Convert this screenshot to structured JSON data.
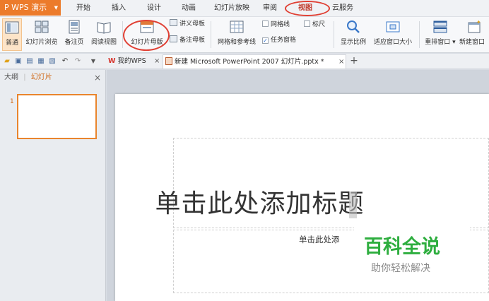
{
  "app": {
    "name": "WPS 演示"
  },
  "menu": {
    "tabs": [
      "开始",
      "插入",
      "设计",
      "动画",
      "幻灯片放映",
      "审阅",
      "视图",
      "云服务"
    ],
    "active": "视图"
  },
  "ribbon": {
    "buttons": [
      "普通",
      "幻灯片浏览",
      "备注页",
      "阅读视图",
      "幻灯片母版",
      "网格和参考线",
      "显示比例",
      "适应窗口大小",
      "重排窗口",
      "新建窗口"
    ],
    "small": {
      "handout_master": "讲义母板",
      "notes_master": "备注母板",
      "gridlines": "网格线",
      "ruler": "标尺",
      "task_pane": "任务窗格"
    }
  },
  "doc_tabs": [
    {
      "label": "我的WPS",
      "close": "×"
    },
    {
      "label": "新建 Microsoft PowerPoint 2007 幻灯片.pptx *",
      "close": "×"
    }
  ],
  "new_tab": "+",
  "sidebar": {
    "tab_outline": "大纲",
    "tab_slides": "幻灯片",
    "close": "×",
    "slide_number": "1"
  },
  "slide": {
    "title": "单击此处添加标题",
    "subtitle": "单击此处添"
  },
  "watermark": {
    "main": "百科全说",
    "sub": "助你轻松解决"
  },
  "colors": {
    "accent": "#ec7b2b",
    "active_tab": "#c0392b",
    "watermark_green": "#2eae3f",
    "annotation_red": "#e04034"
  }
}
